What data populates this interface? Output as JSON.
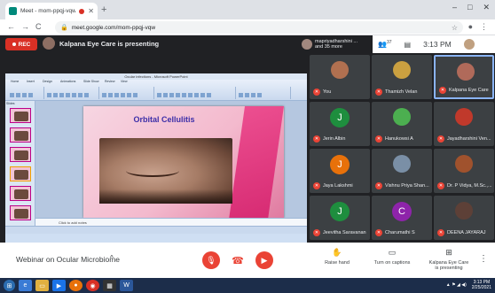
{
  "browser": {
    "tab_title": "Meet - mom-ppqj-vqw",
    "new_tab": "+",
    "win_controls": [
      "–",
      "□",
      "✕"
    ],
    "url": "meet.google.com/mom-ppqj-vqw",
    "nav": [
      "←",
      "→",
      "C"
    ]
  },
  "meet": {
    "rec_label": "REC",
    "presenter_text": "Kalpana Eye Care is presenting",
    "people_chip_line1": "mapriyadharshini ...",
    "people_chip_line2": "and 35 more",
    "participant_count": "37",
    "time": "3:13 PM",
    "me_label": "You"
  },
  "presentation": {
    "window_title": "Ocular infections - Microsoft PowerPoint",
    "ribbon_tabs": [
      "Home",
      "Insert",
      "Design",
      "Animations",
      "Slide Show",
      "Review",
      "View"
    ],
    "slides_tab": "Slides",
    "slide_title": "Orbital Cellulitis",
    "notes_text": "Click to add notes"
  },
  "participants": [
    {
      "name": "You",
      "type": "photo",
      "color": "#b07050"
    },
    {
      "name": "Thamizh Velan",
      "type": "photo",
      "color": "#caa040"
    },
    {
      "name": "Kalpana Eye Care",
      "type": "photo",
      "color": "#b06a5a",
      "highlight": true
    },
    {
      "name": "Jerin Albin",
      "type": "letter",
      "letter": "J",
      "color": "#1e8e3e"
    },
    {
      "name": "Hanukowsi A",
      "type": "photo",
      "color": "#4caf50"
    },
    {
      "name": "Jayadharshini Ven...",
      "type": "photo",
      "color": "#c0392b"
    },
    {
      "name": "Jaya Lakshmi",
      "type": "letter",
      "letter": "J",
      "color": "#e8710a"
    },
    {
      "name": "Vishnu Priya Shan...",
      "type": "photo",
      "color": "#7a8fa6"
    },
    {
      "name": "Dr. P Vidya, M.Sc.,...",
      "type": "photo",
      "color": "#a0522d"
    },
    {
      "name": "Jeevitha Saravanan",
      "type": "letter",
      "letter": "J",
      "color": "#1e8e3e"
    },
    {
      "name": "Charumathi S",
      "type": "letter",
      "letter": "C",
      "color": "#8e24aa"
    },
    {
      "name": "DEENA JAYARAJ",
      "type": "photo",
      "color": "#5d4037"
    }
  ],
  "controls": {
    "meeting_title": "Webinar on Ocular Microbiome",
    "caret": "^",
    "raise_hand": "Raise hand",
    "captions": "Turn on captions",
    "presenting_line1": "Kalpana Eye Care",
    "presenting_line2": "is presenting",
    "more": "⋮"
  },
  "taskbar": {
    "clock_time": "3:13 PM",
    "clock_date": "2/25/2021"
  },
  "colors": {
    "accent_red": "#ea4335",
    "meet_dark": "#202124",
    "slide_title": "#3c2ea8"
  }
}
